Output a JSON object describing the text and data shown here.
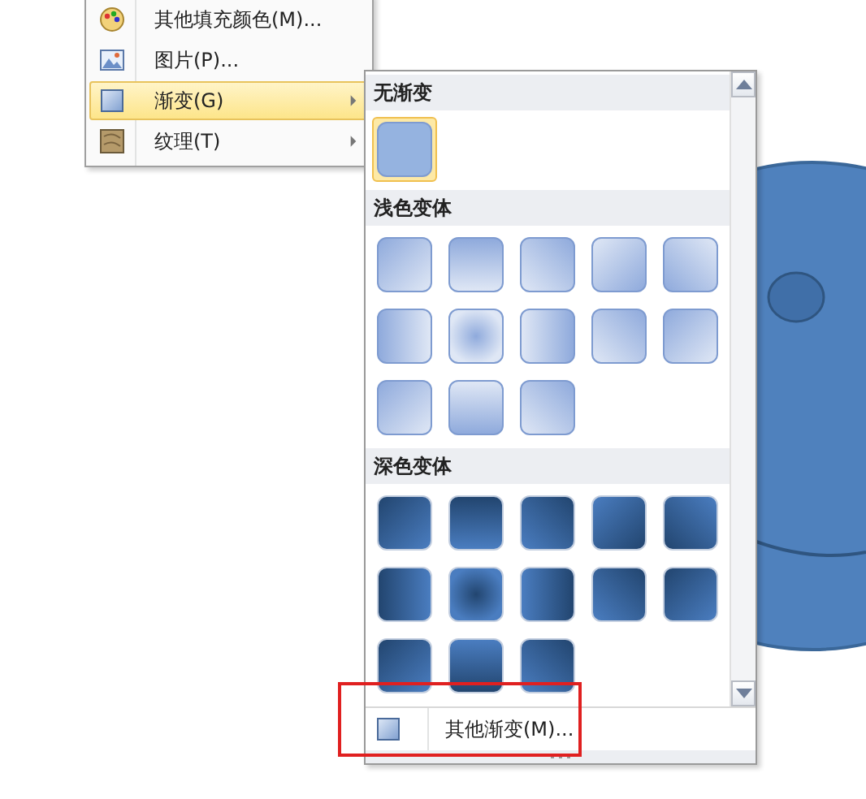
{
  "context_menu": {
    "items": [
      {
        "label": "其他填充颜色(M)...",
        "kind": "palette",
        "has_submenu": false,
        "selected": false
      },
      {
        "label": "图片(P)...",
        "kind": "picture",
        "has_submenu": false,
        "selected": false
      },
      {
        "label": "渐变(G)",
        "kind": "gradient",
        "has_submenu": true,
        "selected": true
      },
      {
        "label": "纹理(T)",
        "kind": "texture",
        "has_submenu": true,
        "selected": false
      }
    ]
  },
  "gradient_gallery": {
    "sections": [
      {
        "title": "无渐变",
        "kind": "flat",
        "swatches": [
          {
            "kind": "none",
            "selected": true
          }
        ]
      },
      {
        "title": "浅色变体",
        "kind": "light",
        "swatches": [
          {
            "kind": "top-left",
            "selected": false
          },
          {
            "kind": "top",
            "selected": false
          },
          {
            "kind": "top-right",
            "selected": false
          },
          {
            "kind": "bottom-right",
            "selected": false
          },
          {
            "kind": "bottom-left",
            "selected": false
          },
          {
            "kind": "left",
            "selected": false
          },
          {
            "kind": "center",
            "selected": false
          },
          {
            "kind": "right",
            "selected": false
          },
          {
            "kind": "top-right",
            "selected": false
          },
          {
            "kind": "top-left",
            "selected": false
          },
          {
            "kind": "top-left",
            "selected": false
          },
          {
            "kind": "bottom",
            "selected": false
          },
          {
            "kind": "top-right",
            "selected": false
          }
        ]
      },
      {
        "title": "深色变体",
        "kind": "dark",
        "swatches": [
          {
            "kind": "top-left",
            "selected": false
          },
          {
            "kind": "top",
            "selected": false
          },
          {
            "kind": "top-right",
            "selected": false
          },
          {
            "kind": "bottom-right",
            "selected": false
          },
          {
            "kind": "bottom-left",
            "selected": false
          },
          {
            "kind": "left",
            "selected": false
          },
          {
            "kind": "center",
            "selected": false
          },
          {
            "kind": "right",
            "selected": false
          },
          {
            "kind": "top-right",
            "selected": false
          },
          {
            "kind": "top-left",
            "selected": false
          },
          {
            "kind": "top-left",
            "selected": false
          },
          {
            "kind": "bottom",
            "selected": false
          },
          {
            "kind": "top-right",
            "selected": false
          }
        ]
      }
    ],
    "more_option": {
      "label": "其他渐变(M)...",
      "highlighted": true
    }
  }
}
